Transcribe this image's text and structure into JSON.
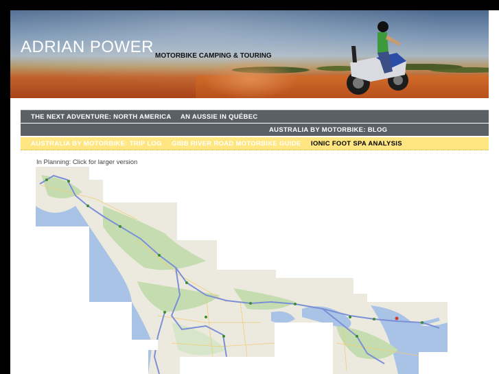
{
  "site": {
    "title": "ADRIAN POWER",
    "tagline": "MOTORBIKE CAMPING & TOURING"
  },
  "nav": {
    "primary": [
      {
        "label": "THE NEXT ADVENTURE: NORTH AMERICA"
      },
      {
        "label": "AN AUSSIE IN QUÉBEC"
      }
    ],
    "secondary": [
      {
        "label": "AUSTRALIA BY MOTORBIKE: BLOG"
      }
    ],
    "tertiary": [
      {
        "label": "AUSTRALIA BY MOTORBIKE: TRIP LOG"
      },
      {
        "label": "GIBB RIVER ROAD MOTORBIKE GUIDE"
      },
      {
        "label": "IONIC FOOT SPA ANALYSIS",
        "active": true
      }
    ]
  },
  "main": {
    "caption": "In Planning: Click for larger version"
  },
  "colors": {
    "page_background": "#000000",
    "nav_bar": "#5b6066",
    "nav_highlight_bar": "#ffe680",
    "map_water": "#a9c3e6",
    "map_land": "#eceadf",
    "map_forest": "#c5dcb1",
    "route": "#7a8fd6"
  }
}
